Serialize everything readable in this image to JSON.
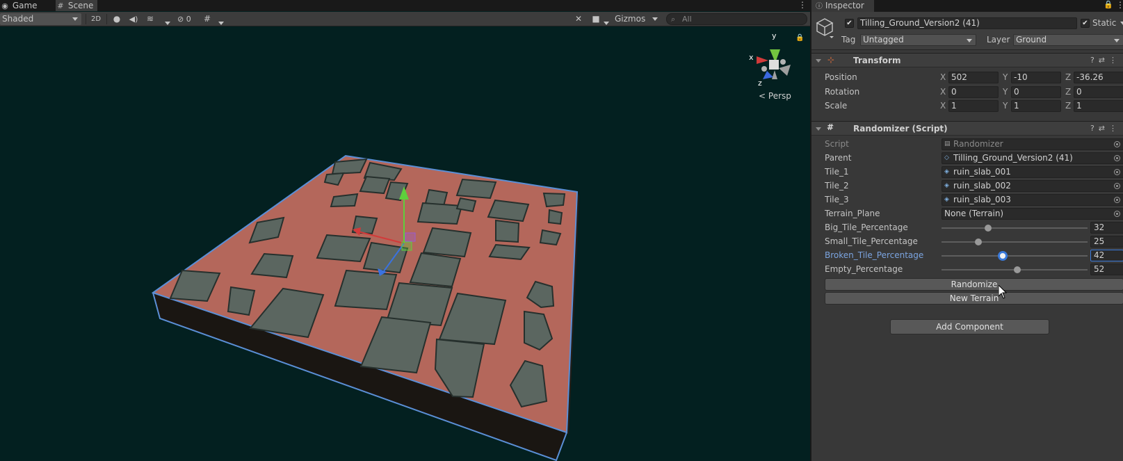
{
  "tabs": [
    {
      "label": "Game",
      "icon": "gamepad-icon",
      "active": false
    },
    {
      "label": "Scene",
      "icon": "grid-icon",
      "active": true
    }
  ],
  "scene_toolbar": {
    "shading_mode": "Shaded",
    "mode_2d": "2D",
    "hidden_count": "0",
    "gizmos_label": "Gizmos",
    "search_placeholder": "All"
  },
  "viewport": {
    "projection_label": "Persp",
    "axis_labels": {
      "x": "x",
      "y": "y",
      "z": "z"
    },
    "selection_outline_color": "#5b8fd6",
    "terrain_color": "#b4675b",
    "slab_color": "#5b6660",
    "background_color": "#032020"
  },
  "inspector": {
    "tab_label": "Inspector",
    "object": {
      "enabled": true,
      "name": "Tilling_Ground_Version2 (41)",
      "static_label": "Static",
      "static_checked": true,
      "tag_label": "Tag",
      "tag_value": "Untagged",
      "layer_label": "Layer",
      "layer_value": "Ground"
    },
    "transform": {
      "title": "Transform",
      "rows": [
        {
          "label": "Position",
          "x": "502",
          "y": "-10",
          "z": "-36.26"
        },
        {
          "label": "Rotation",
          "x": "0",
          "y": "0",
          "z": "0"
        },
        {
          "label": "Scale",
          "x": "1",
          "y": "1",
          "z": "1"
        }
      ],
      "axis_x": "X",
      "axis_y": "Y",
      "axis_z": "Z"
    },
    "randomizer": {
      "title": "Randomizer (Script)",
      "script_label": "Script",
      "script_value": "Randomizer",
      "object_fields": [
        {
          "label": "Parent",
          "value": "Tilling_Ground_Version2 (41)",
          "icon": "gameobject-icon"
        },
        {
          "label": "Tile_1",
          "value": "ruin_slab_001",
          "icon": "prefab-icon"
        },
        {
          "label": "Tile_2",
          "value": "ruin_slab_002",
          "icon": "prefab-icon"
        },
        {
          "label": "Tile_3",
          "value": "ruin_slab_003",
          "icon": "prefab-icon"
        },
        {
          "label": "Terrain_Plane",
          "value": "None (Terrain)",
          "icon": ""
        }
      ],
      "sliders": [
        {
          "label": "Big_Tile_Percentage",
          "value": 32,
          "display": "32",
          "active": false
        },
        {
          "label": "Small_Tile_Percentage",
          "value": 25,
          "display": "25",
          "active": false
        },
        {
          "label": "Broken_Tile_Percentage",
          "value": 42,
          "display": "42",
          "active": true
        },
        {
          "label": "Empty_Percentage",
          "value": 52,
          "display": "52",
          "active": false
        }
      ],
      "slider_max": 100,
      "randomize_label": "Randomize",
      "new_terrain_label": "New Terrain"
    },
    "add_component_label": "Add Component"
  }
}
